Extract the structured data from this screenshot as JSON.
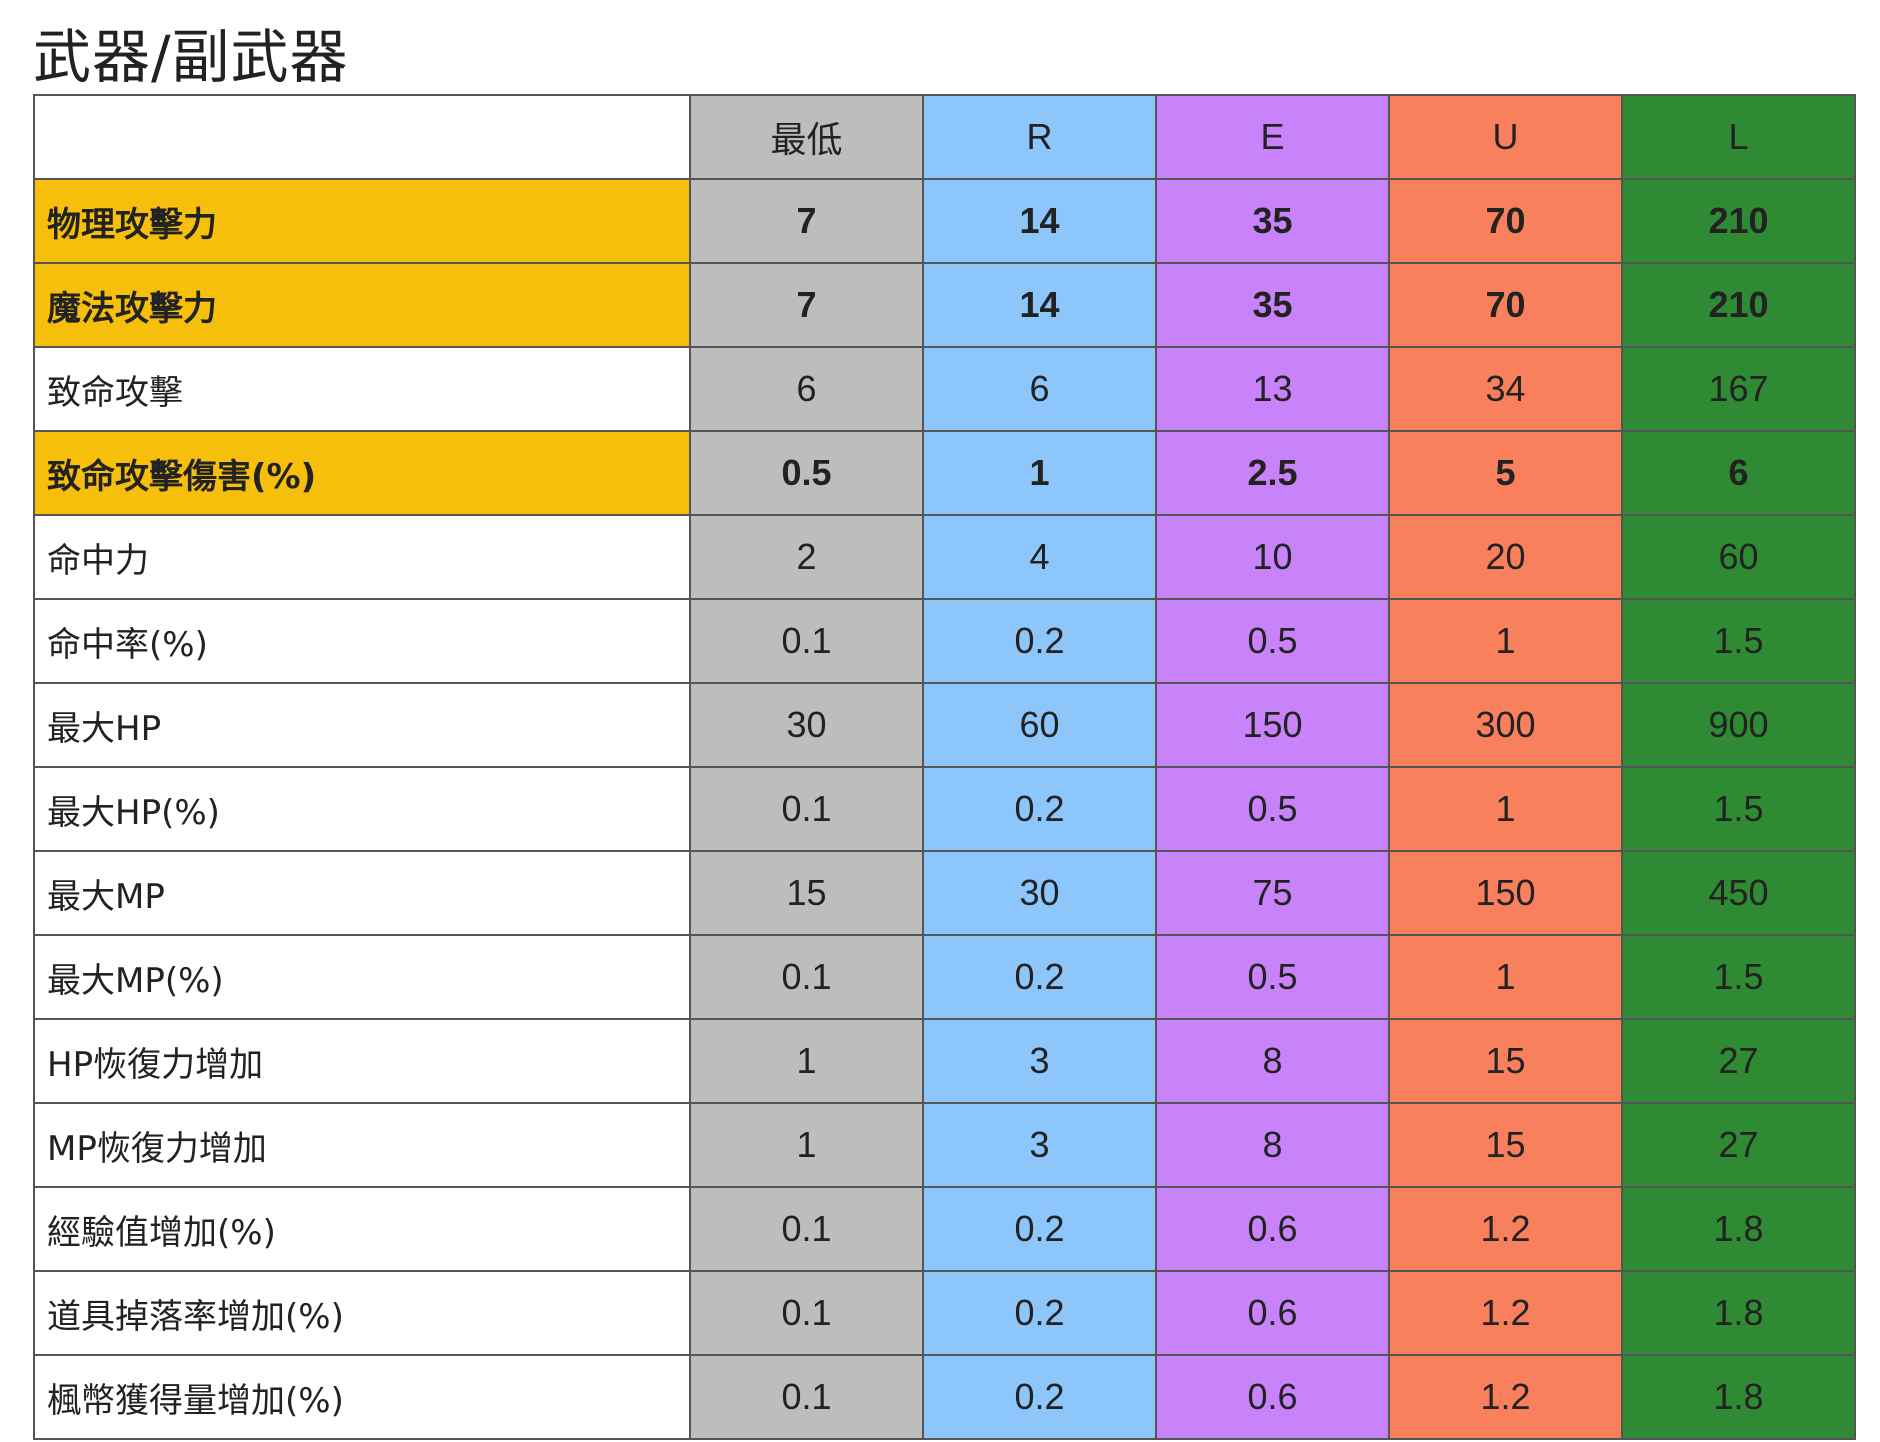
{
  "title": "武器/副武器",
  "columns": [
    "最低",
    "R",
    "E",
    "U",
    "L"
  ],
  "colors": {
    "highlight": "#f5bf0c",
    "最低": "#bdbdbd",
    "R": "#8cc6fa",
    "E": "#c882fa",
    "U": "#f8805c",
    "L": "#2f8a34"
  },
  "rows": [
    {
      "label": "物理攻擊力",
      "highlight": true,
      "values": [
        "7",
        "14",
        "35",
        "70",
        "210"
      ]
    },
    {
      "label": "魔法攻擊力",
      "highlight": true,
      "values": [
        "7",
        "14",
        "35",
        "70",
        "210"
      ]
    },
    {
      "label": "致命攻擊",
      "highlight": false,
      "values": [
        "6",
        "6",
        "13",
        "34",
        "167"
      ]
    },
    {
      "label": "致命攻擊傷害(%)",
      "highlight": true,
      "values": [
        "0.5",
        "1",
        "2.5",
        "5",
        "6"
      ]
    },
    {
      "label": "命中力",
      "highlight": false,
      "values": [
        "2",
        "4",
        "10",
        "20",
        "60"
      ]
    },
    {
      "label": "命中率(%)",
      "highlight": false,
      "values": [
        "0.1",
        "0.2",
        "0.5",
        "1",
        "1.5"
      ]
    },
    {
      "label": "最大HP",
      "highlight": false,
      "values": [
        "30",
        "60",
        "150",
        "300",
        "900"
      ]
    },
    {
      "label": "最大HP(%)",
      "highlight": false,
      "values": [
        "0.1",
        "0.2",
        "0.5",
        "1",
        "1.5"
      ]
    },
    {
      "label": "最大MP",
      "highlight": false,
      "values": [
        "15",
        "30",
        "75",
        "150",
        "450"
      ]
    },
    {
      "label": "最大MP(%)",
      "highlight": false,
      "values": [
        "0.1",
        "0.2",
        "0.5",
        "1",
        "1.5"
      ]
    },
    {
      "label": "HP恢復力增加",
      "highlight": false,
      "values": [
        "1",
        "3",
        "8",
        "15",
        "27"
      ]
    },
    {
      "label": "MP恢復力增加",
      "highlight": false,
      "values": [
        "1",
        "3",
        "8",
        "15",
        "27"
      ]
    },
    {
      "label": "經驗值增加(%)",
      "highlight": false,
      "values": [
        "0.1",
        "0.2",
        "0.6",
        "1.2",
        "1.8"
      ]
    },
    {
      "label": "道具掉落率增加(%)",
      "highlight": false,
      "values": [
        "0.1",
        "0.2",
        "0.6",
        "1.2",
        "1.8"
      ]
    },
    {
      "label": "楓幣獲得量增加(%)",
      "highlight": false,
      "values": [
        "0.1",
        "0.2",
        "0.6",
        "1.2",
        "1.8"
      ]
    }
  ]
}
